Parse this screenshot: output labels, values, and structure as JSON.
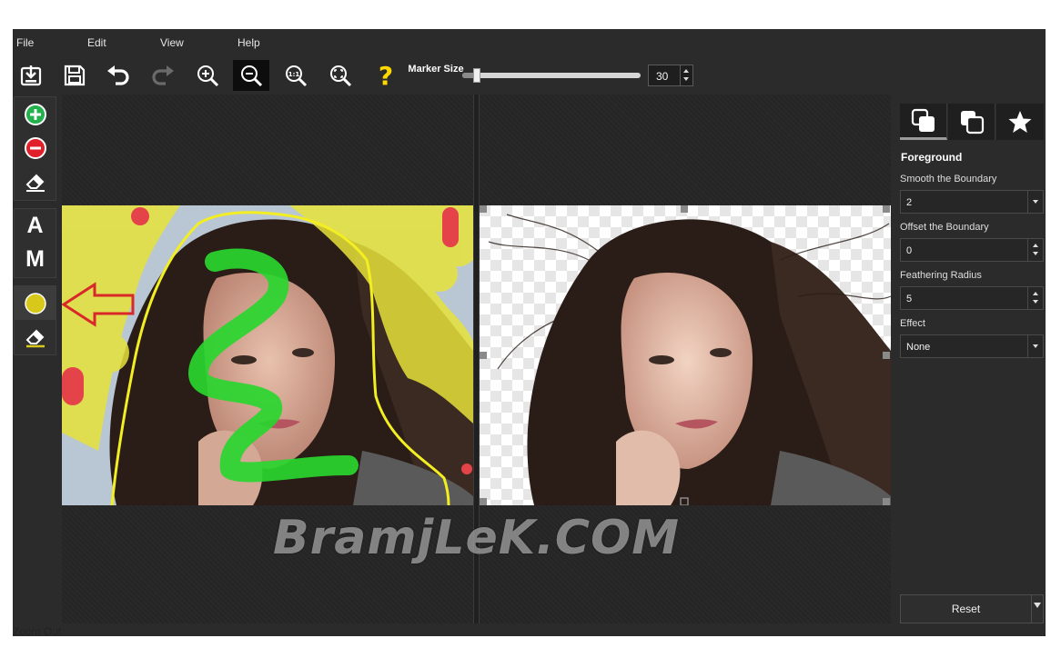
{
  "menu": [
    "File",
    "Edit",
    "View",
    "Help"
  ],
  "toolbar": {
    "icons": [
      "import-icon",
      "save-icon",
      "undo-icon",
      "redo-icon",
      "zoom-in-icon",
      "zoom-out-icon",
      "actual-size-icon",
      "fit-screen-icon",
      "help-icon"
    ],
    "marker_label": "Marker Size",
    "marker_value": "30",
    "marker_slider_fraction": 0.03
  },
  "left_tools": {
    "groups": [
      [
        "add-foreground-icon",
        "remove-background-icon",
        "eraser-icon"
      ],
      [
        "A",
        "M"
      ],
      [
        "hair-marker-icon",
        "hair-eraser-icon"
      ]
    ],
    "colors": {
      "add": "#22b14c",
      "remove": "#e0202a",
      "hair": "#d8c81a",
      "arrow": "#d8282a"
    }
  },
  "right_panel": {
    "tabs": [
      "foreground-tab-icon",
      "background-tab-icon",
      "effects-star-icon"
    ],
    "section_title": "Foreground",
    "smooth_label": "Smooth the Boundary",
    "smooth_value": "2",
    "offset_label": "Offset the Boundary",
    "offset_value": "0",
    "feather_label": "Feathering Radius",
    "feather_value": "5",
    "effect_label": "Effect",
    "effect_value": "None",
    "reset_label": "Reset"
  },
  "watermark": "BramjLeK.COM",
  "status": "Zoom Out"
}
